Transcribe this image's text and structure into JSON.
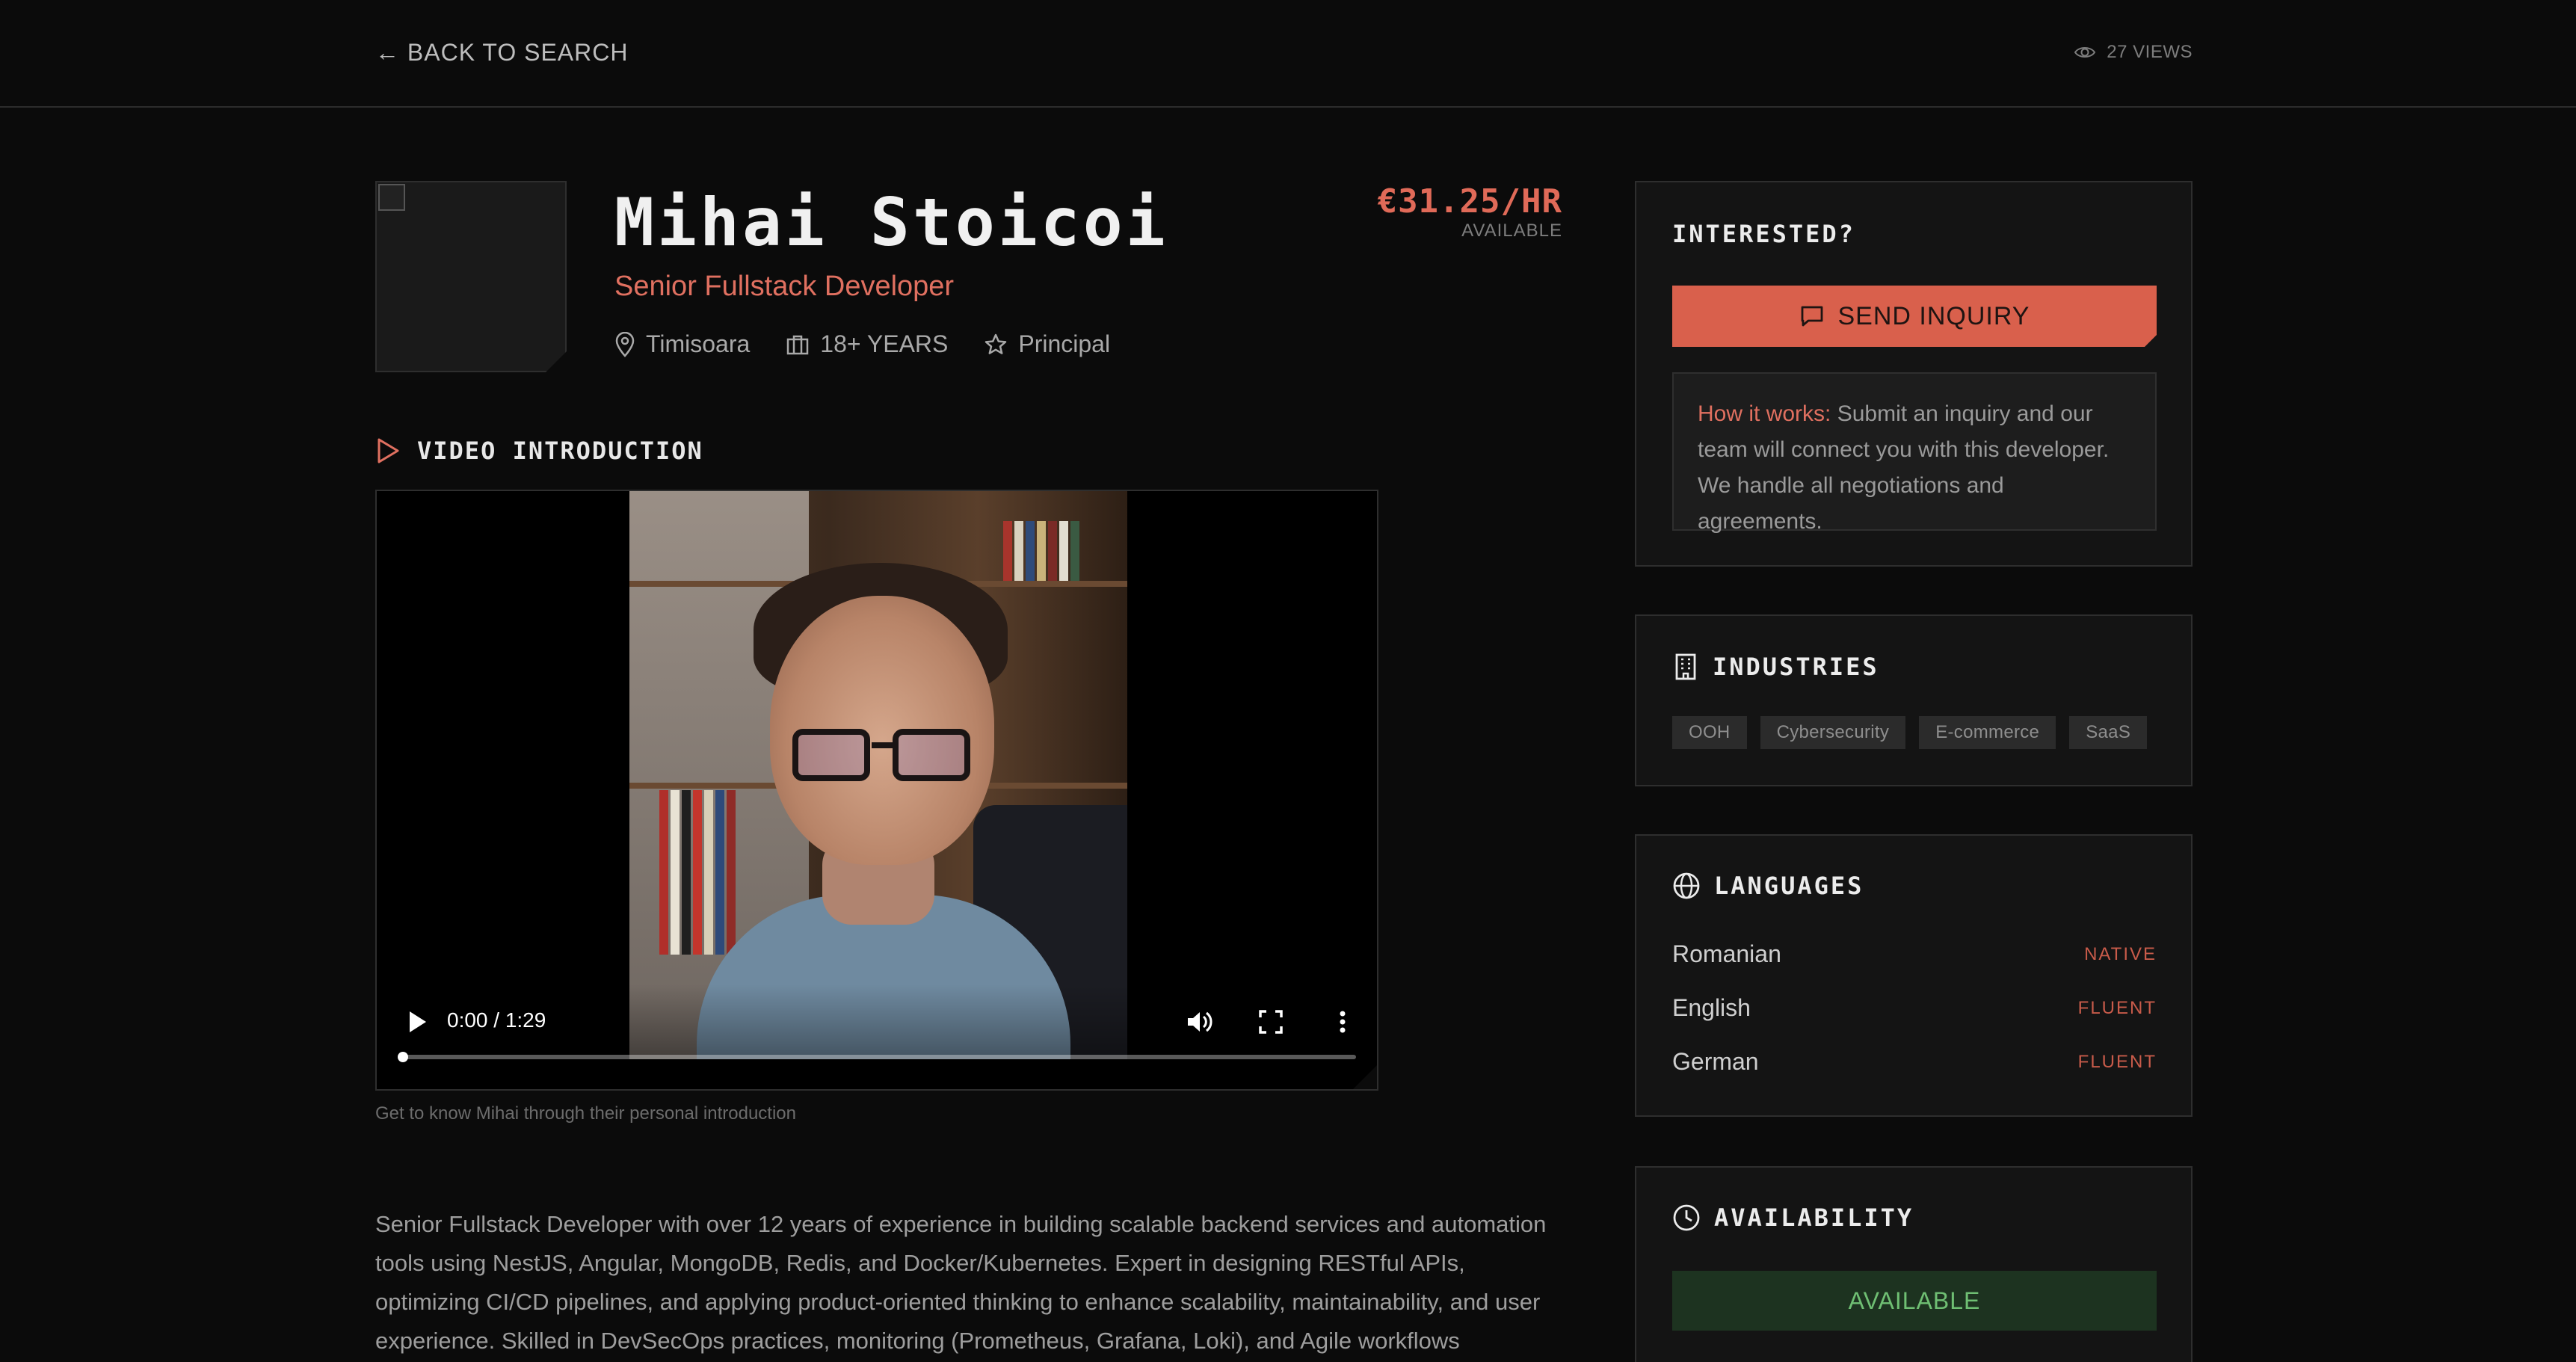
{
  "nav": {
    "back_label": "← BACK TO SEARCH",
    "views_label": "27 VIEWS"
  },
  "profile": {
    "name": "Mihai Stoicoi",
    "role": "Senior Fullstack Developer",
    "location": "Timisoara",
    "experience": "18+ YEARS",
    "seniority": "Principal",
    "rate": "€31.25/HR",
    "rate_status": "AVAILABLE"
  },
  "video": {
    "section_title": "VIDEO INTRODUCTION",
    "time": "0:00 / 1:29",
    "progress": 0,
    "caption": "Get to know Mihai through their personal introduction"
  },
  "bio": "Senior Fullstack Developer with over 12 years of experience in building scalable backend services and automation tools using NestJS, Angular, MongoDB, Redis, and Docker/Kubernetes. Expert in designing RESTful APIs, optimizing CI/CD pipelines, and applying product-oriented thinking to enhance scalability, maintainability, and user experience. Skilled in DevSecOps practices, monitoring (Prometheus, Grafana, Loki), and Agile workflows",
  "inquiry": {
    "title": "INTERESTED?",
    "button_label": "SEND INQUIRY",
    "how_label": "How it works:",
    "how_text": " Submit an inquiry and our team will connect you with this developer. We handle all negotiations and agreements."
  },
  "industries": {
    "title": "INDUSTRIES",
    "items": [
      "OOH",
      "Cybersecurity",
      "E-commerce",
      "SaaS"
    ]
  },
  "languages": {
    "title": "LANGUAGES",
    "items": [
      {
        "name": "Romanian",
        "level": "NATIVE"
      },
      {
        "name": "English",
        "level": "FLUENT"
      },
      {
        "name": "German",
        "level": "FLUENT"
      }
    ]
  },
  "availability": {
    "title": "AVAILABILITY",
    "status": "AVAILABLE"
  },
  "colors": {
    "accent": "#d9604c",
    "background": "#0b0b0b",
    "card": "#141414",
    "available_green": "#6fbf73"
  },
  "icons": {
    "back": "arrow-left-icon",
    "views": "eye-icon",
    "location": "map-pin-icon",
    "experience": "briefcase-icon",
    "seniority": "star-icon",
    "video": "play-outline-icon",
    "inquiry": "message-square-icon",
    "industries": "building-icon",
    "languages": "globe-icon",
    "availability": "clock-icon"
  }
}
